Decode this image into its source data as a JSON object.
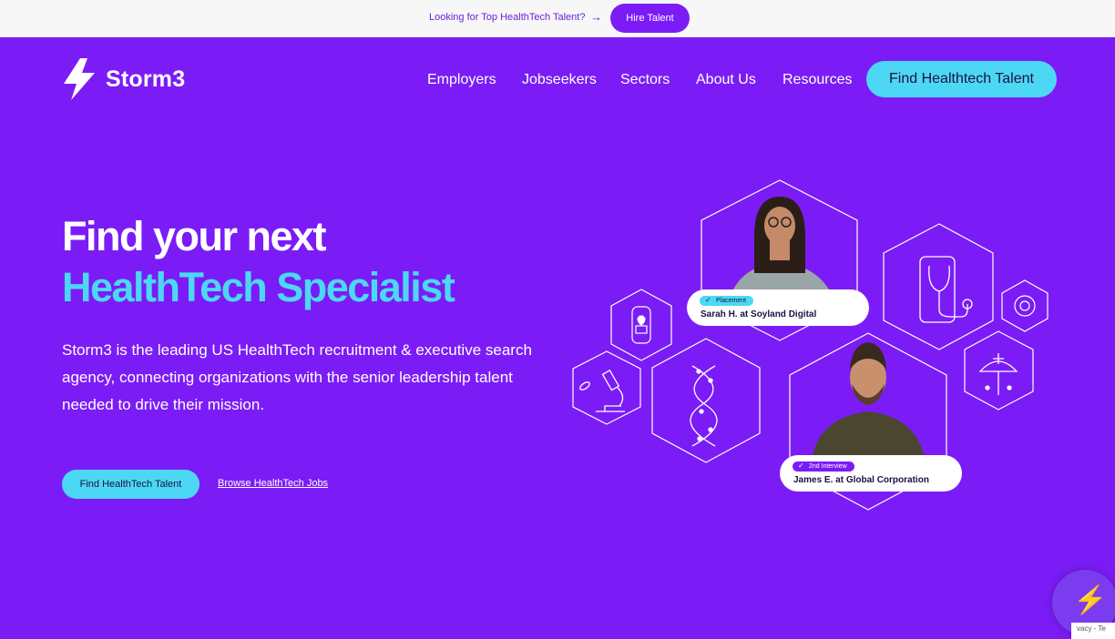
{
  "topbar": {
    "message": "Looking for Top HealthTech Talent?",
    "arrow": "→",
    "hire_label": "Hire Talent"
  },
  "header": {
    "logo_text": "Storm3",
    "nav": [
      "Employers",
      "Jobseekers",
      "Sectors",
      "About Us",
      "Resources"
    ],
    "cta_label": "Find Healthtech Talent"
  },
  "hero": {
    "title_line1": "Find your next",
    "title_line2": "HealthTech Specialist",
    "lead": "Storm3 is the leading US HealthTech recruitment & executive search agency, connecting organizations with the senior leadership talent needed to drive their mission.",
    "primary_button": "Find HealthTech Talent",
    "secondary_link": "Browse HealthTech Jobs"
  },
  "cards": [
    {
      "badge": "Placement",
      "badge_color": "#4cd8f4",
      "text": "Sarah H. at Soyland Digital"
    },
    {
      "badge": "2nd Interview",
      "badge_color": "#7b1cf7",
      "text": "James E. at Global Corporation"
    }
  ],
  "chat": {
    "icon": "lightning-icon",
    "glyph": "⚡"
  },
  "recaptcha": {
    "text": "vacy - Te"
  },
  "colors": {
    "brand_purple": "#7b1cf7",
    "accent_cyan": "#4cd8f4",
    "ink": "#1c1145"
  }
}
